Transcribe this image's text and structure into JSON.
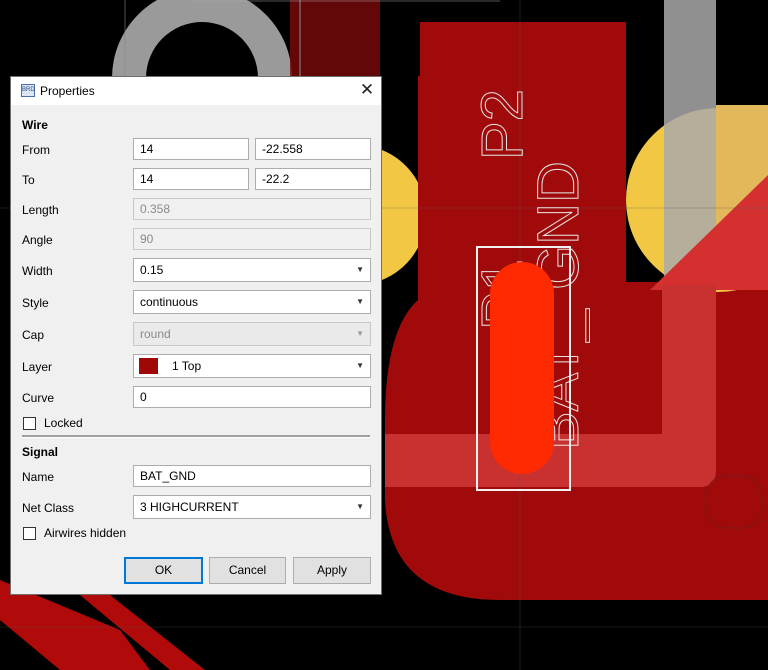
{
  "dialog": {
    "title": "Properties",
    "icon_text": "BRD",
    "close_glyph": "✕"
  },
  "wire": {
    "section": "Wire",
    "from_label": "From",
    "from_x": "14",
    "from_y": "-22.558",
    "to_label": "To",
    "to_x": "14",
    "to_y": "-22.2",
    "length_label": "Length",
    "length": "0.358",
    "angle_label": "Angle",
    "angle": "90",
    "width_label": "Width",
    "width": "0.15",
    "style_label": "Style",
    "style": "continuous",
    "cap_label": "Cap",
    "cap": "round",
    "layer_label": "Layer",
    "layer": "1 Top",
    "layer_color": "#a00808",
    "curve_label": "Curve",
    "curve": "0",
    "locked_label": "Locked",
    "locked": false
  },
  "signal": {
    "section": "Signal",
    "name_label": "Name",
    "name": "BAT_GND",
    "netclass_label": "Net Class",
    "netclass": "3 HIGHCURRENT",
    "airwires_label": "Airwires hidden",
    "airwires_hidden": false
  },
  "buttons": {
    "ok": "OK",
    "cancel": "Cancel",
    "apply": "Apply"
  },
  "board": {
    "silkscreen_labels": [
      "P2",
      "GND",
      "P1",
      "BAT_"
    ],
    "copper_color": "#a00a0a",
    "pad_color": "#ff2a00",
    "hole_color": "#f2c744"
  }
}
